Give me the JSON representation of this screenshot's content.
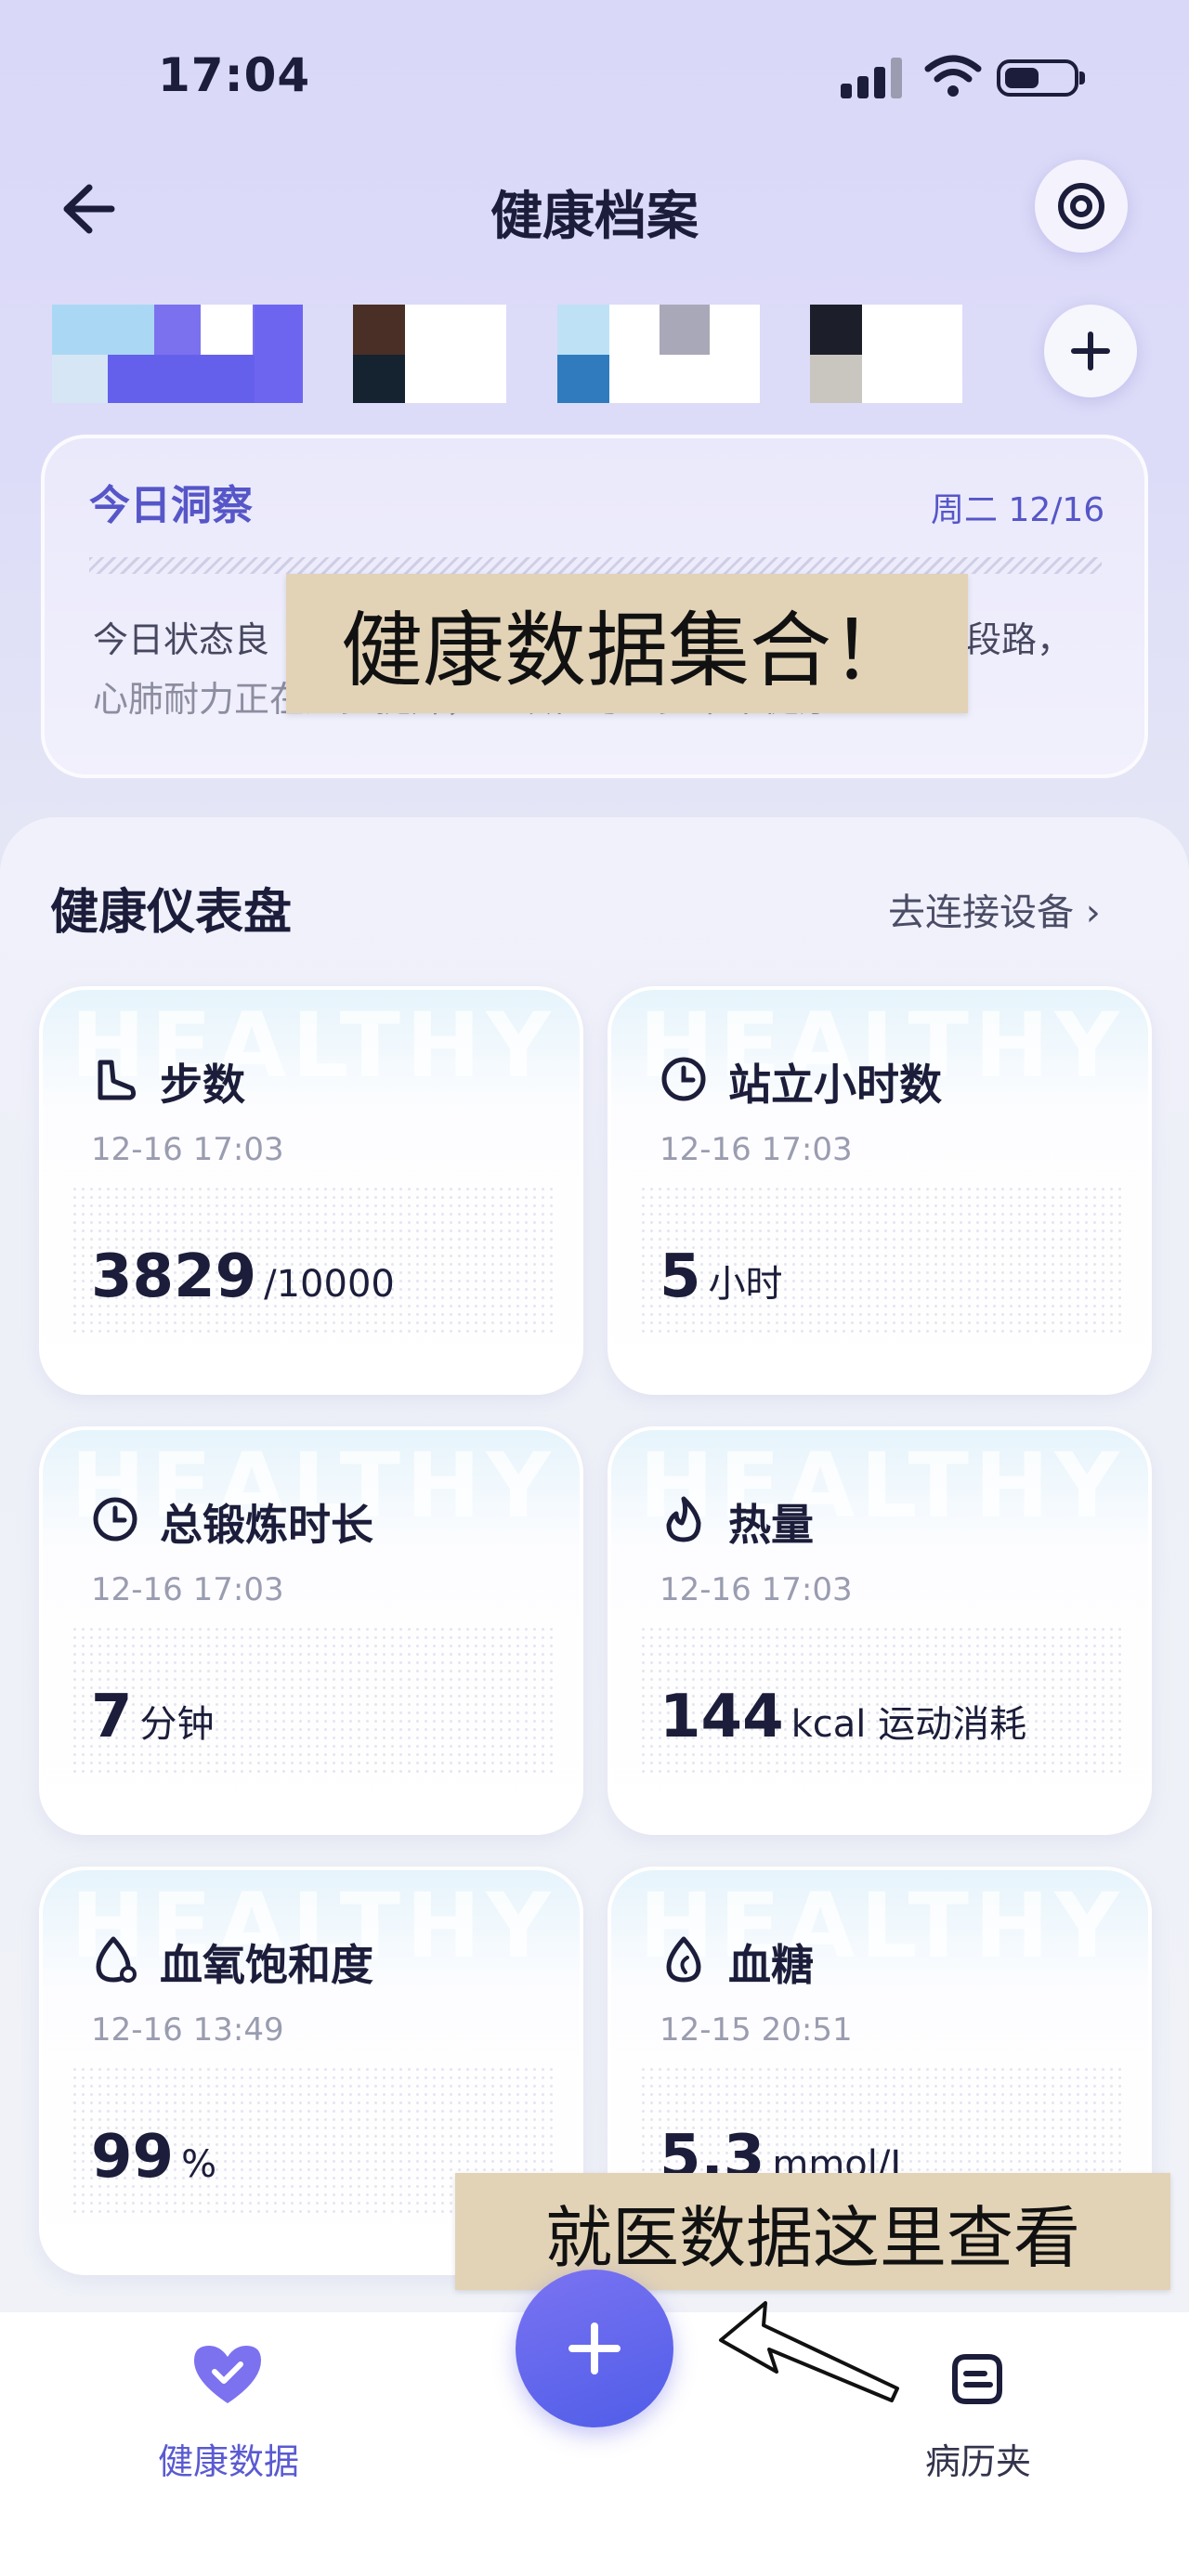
{
  "status_bar": {
    "time": "17:04"
  },
  "header": {
    "title": "健康档案"
  },
  "insight": {
    "title": "今日洞察",
    "date": "周二 12/16",
    "line1_left": "今日状态良",
    "line1_right": "段路，",
    "line2": "心肺耐力正在逐步提升，继续往与一步下个健康",
    "overlay": "健康数据集合！"
  },
  "dashboard": {
    "title": "健康仪表盘",
    "link": "去连接设备 ›",
    "watermark": "HEALTHY",
    "cards": [
      {
        "title": "步数",
        "time": "12-16 17:03",
        "value": "3829",
        "unit": "/10000",
        "icon": "steps-icon"
      },
      {
        "title": "站立小时数",
        "time": "12-16 17:03",
        "value": "5",
        "unit": "小时",
        "icon": "clock-icon"
      },
      {
        "title": "总锻炼时长",
        "time": "12-16 17:03",
        "value": "7",
        "unit": "分钟",
        "icon": "timer-icon"
      },
      {
        "title": "热量",
        "time": "12-16 17:03",
        "value": "144",
        "unit": "kcal 运动消耗",
        "icon": "flame-icon"
      },
      {
        "title": "血氧饱和度",
        "time": "12-16 13:49",
        "value": "99",
        "unit": "%",
        "icon": "droplet-icon"
      },
      {
        "title": "血糖",
        "time": "12-15 20:51",
        "value": "5.3",
        "unit": "mmol/L",
        "icon": "blood-sugar-icon"
      }
    ]
  },
  "bottom_nav": {
    "item1": "健康数据",
    "item2": "病历夹",
    "overlay": "就医数据这里查看"
  },
  "colors": {
    "accent": "#5a5ad2",
    "sticker": "#e2d3b7"
  }
}
